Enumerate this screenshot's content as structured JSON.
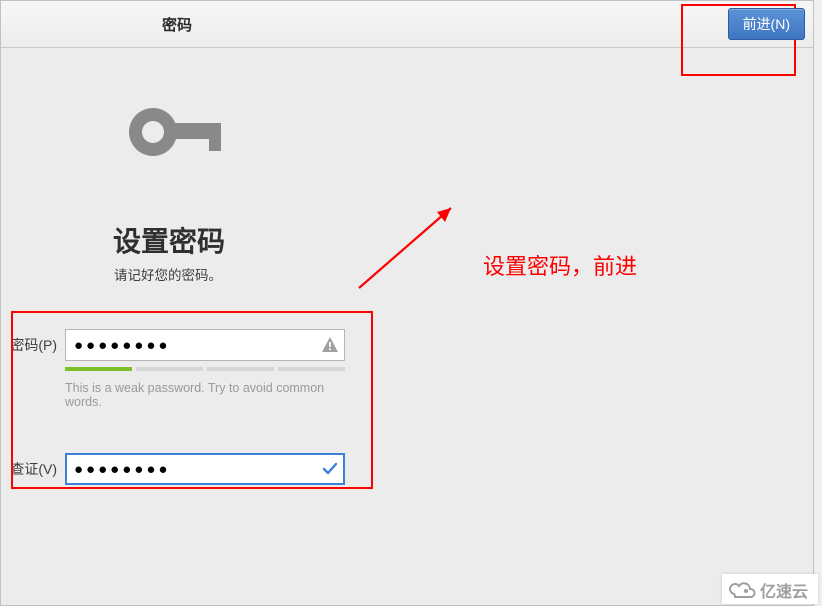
{
  "titlebar": {
    "title": "密码",
    "next_label": "前进(N)"
  },
  "header": {
    "heading": "设置密码",
    "subheading": "请记好您的密码。"
  },
  "form": {
    "password_label": "密码(P)",
    "password_value": "●●●●●●●●",
    "password_status_icon": "warning-icon",
    "strength_segments_on": 1,
    "strength_segments_total": 4,
    "hint": "This is a weak password. Try to avoid common words.",
    "verify_label": "查证(V)",
    "verify_value": "●●●●●●●●",
    "verify_status_icon": "check-icon"
  },
  "annotation": {
    "text": "设置密码，前进",
    "color": "#fe0000"
  },
  "watermark": {
    "text": "亿速云"
  }
}
